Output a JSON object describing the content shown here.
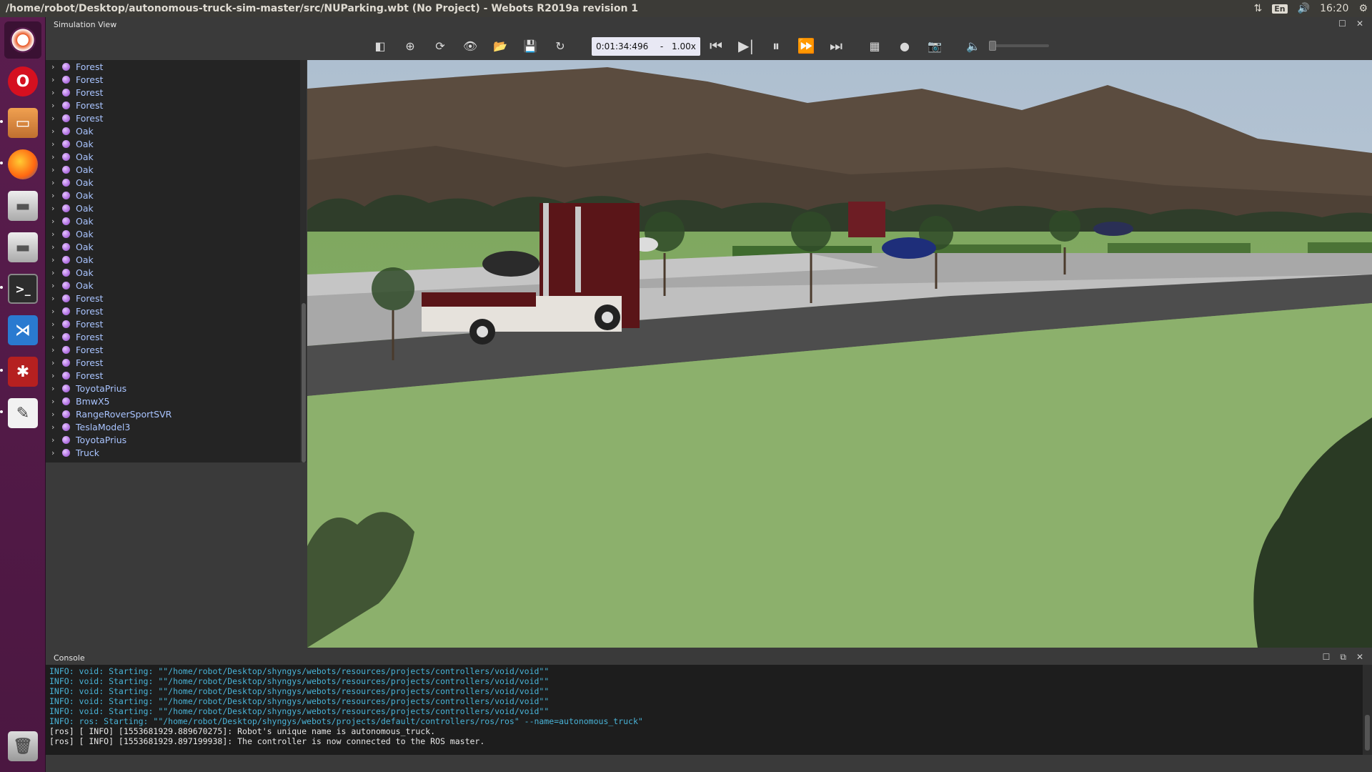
{
  "window": {
    "title": "/home/robot/Desktop/autonomous-truck-sim-master/src/NUParking.wbt (No Project) - Webots R2019a revision 1",
    "tray": {
      "keyboard": "En",
      "clock": "16:20"
    }
  },
  "launcher": {
    "items": [
      "ubuntu-dash",
      "opera",
      "files",
      "firefox",
      "disk-1",
      "disk-2",
      "terminal",
      "vscode",
      "webots",
      "text-editor",
      "trash"
    ]
  },
  "simulation_view": {
    "header": "Simulation View",
    "time": "0:01:34:496",
    "separator": "-",
    "speed": "1.00x"
  },
  "scene_tree": {
    "items": [
      "Forest",
      "Forest",
      "Forest",
      "Forest",
      "Forest",
      "Oak",
      "Oak",
      "Oak",
      "Oak",
      "Oak",
      "Oak",
      "Oak",
      "Oak",
      "Oak",
      "Oak",
      "Oak",
      "Oak",
      "Oak",
      "Forest",
      "Forest",
      "Forest",
      "Forest",
      "Forest",
      "Forest",
      "Forest",
      "ToyotaPrius",
      "BmwX5",
      "RangeRoverSportSVR",
      "TeslaModel3",
      "ToyotaPrius",
      "Truck"
    ]
  },
  "console": {
    "header": "Console",
    "lines": [
      {
        "kind": "info",
        "text": "INFO: void: Starting: \"\"/home/robot/Desktop/shyngys/webots/resources/projects/controllers/void/void\"\""
      },
      {
        "kind": "info",
        "text": "INFO: void: Starting: \"\"/home/robot/Desktop/shyngys/webots/resources/projects/controllers/void/void\"\""
      },
      {
        "kind": "info",
        "text": "INFO: void: Starting: \"\"/home/robot/Desktop/shyngys/webots/resources/projects/controllers/void/void\"\""
      },
      {
        "kind": "info",
        "text": "INFO: void: Starting: \"\"/home/robot/Desktop/shyngys/webots/resources/projects/controllers/void/void\"\""
      },
      {
        "kind": "info",
        "text": "INFO: void: Starting: \"\"/home/robot/Desktop/shyngys/webots/resources/projects/controllers/void/void\"\""
      },
      {
        "kind": "info",
        "text": "INFO: ros: Starting: \"\"/home/robot/Desktop/shyngys/webots/projects/default/controllers/ros/ros\" --name=autonomous_truck\""
      },
      {
        "kind": "ros",
        "text": "[ros] [ INFO] [1553681929.889670275]: Robot's unique name is autonomous_truck."
      },
      {
        "kind": "ros",
        "text": "[ros] [ INFO] [1553681929.897199938]: The controller is now connected to the ROS master."
      }
    ]
  },
  "colors": {
    "tree_text": "#a9c4ff",
    "console_info": "#49b3d7",
    "launcher_bg": "#5a1d4e"
  }
}
